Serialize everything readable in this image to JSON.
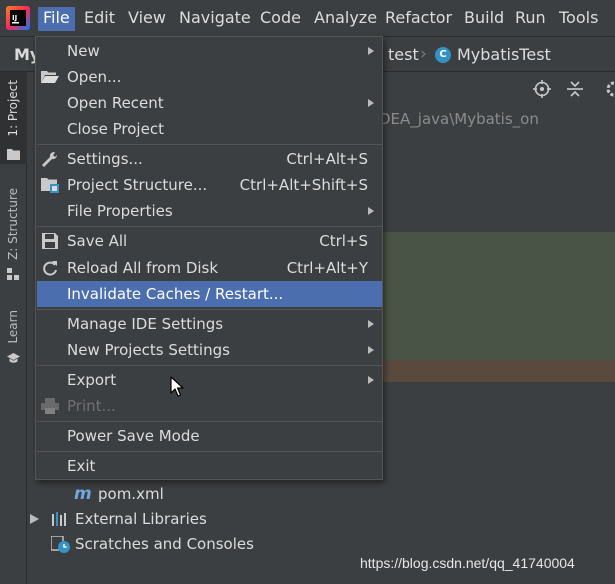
{
  "menubar": {
    "items": [
      "File",
      "Edit",
      "View",
      "Navigate",
      "Code",
      "Analyze",
      "Refactor",
      "Build",
      "Run",
      "Tools"
    ],
    "active": "File"
  },
  "navbar": {
    "project": "My",
    "crumb_test": "test",
    "crumb_class": "MybatisTest"
  },
  "toolstrip": {
    "project_tab": "1: Project",
    "structure_tab": "Z: Structure",
    "learn_tab": "Learn"
  },
  "project_panel": {
    "path": "DEA_java\\Mybatis_on",
    "tree": {
      "pom": "pom.xml",
      "external_libraries": "External Libraries",
      "scratches": "Scratches and Consoles"
    }
  },
  "file_menu": {
    "items": [
      {
        "label": "New",
        "shortcut": "",
        "submenu": true,
        "icon": ""
      },
      {
        "label": "Open...",
        "shortcut": "",
        "submenu": false,
        "icon": "folder-open-icon"
      },
      {
        "label": "Open Recent",
        "shortcut": "",
        "submenu": true,
        "icon": ""
      },
      {
        "label": "Close Project",
        "shortcut": "",
        "submenu": false,
        "icon": ""
      },
      {
        "label": "Settings...",
        "shortcut": "Ctrl+Alt+S",
        "submenu": false,
        "icon": "wrench-icon"
      },
      {
        "label": "Project Structure...",
        "shortcut": "Ctrl+Alt+Shift+S",
        "submenu": false,
        "icon": "project-structure-icon"
      },
      {
        "label": "File Properties",
        "shortcut": "",
        "submenu": true,
        "icon": ""
      },
      {
        "label": "Save All",
        "shortcut": "Ctrl+S",
        "submenu": false,
        "icon": "save-icon"
      },
      {
        "label": "Reload All from Disk",
        "shortcut": "Ctrl+Alt+Y",
        "submenu": false,
        "icon": "reload-icon"
      },
      {
        "label": "Invalidate Caches / Restart...",
        "shortcut": "",
        "submenu": false,
        "icon": "",
        "highlighted": true
      },
      {
        "label": "Manage IDE Settings",
        "shortcut": "",
        "submenu": true,
        "icon": ""
      },
      {
        "label": "New Projects Settings",
        "shortcut": "",
        "submenu": true,
        "icon": ""
      },
      {
        "label": "Export",
        "shortcut": "",
        "submenu": true,
        "icon": ""
      },
      {
        "label": "Print...",
        "shortcut": "",
        "submenu": false,
        "icon": "print-icon",
        "disabled": true
      },
      {
        "label": "Power Save Mode",
        "shortcut": "",
        "submenu": false,
        "icon": ""
      },
      {
        "label": "Exit",
        "shortcut": "",
        "submenu": false,
        "icon": ""
      }
    ]
  },
  "watermark": "https://blog.csdn.net/qq_41740004",
  "colors": {
    "background": "#3c3f41",
    "highlight": "#4b6eaf",
    "text": "#dcdcdc",
    "disabled_text": "#707070"
  }
}
